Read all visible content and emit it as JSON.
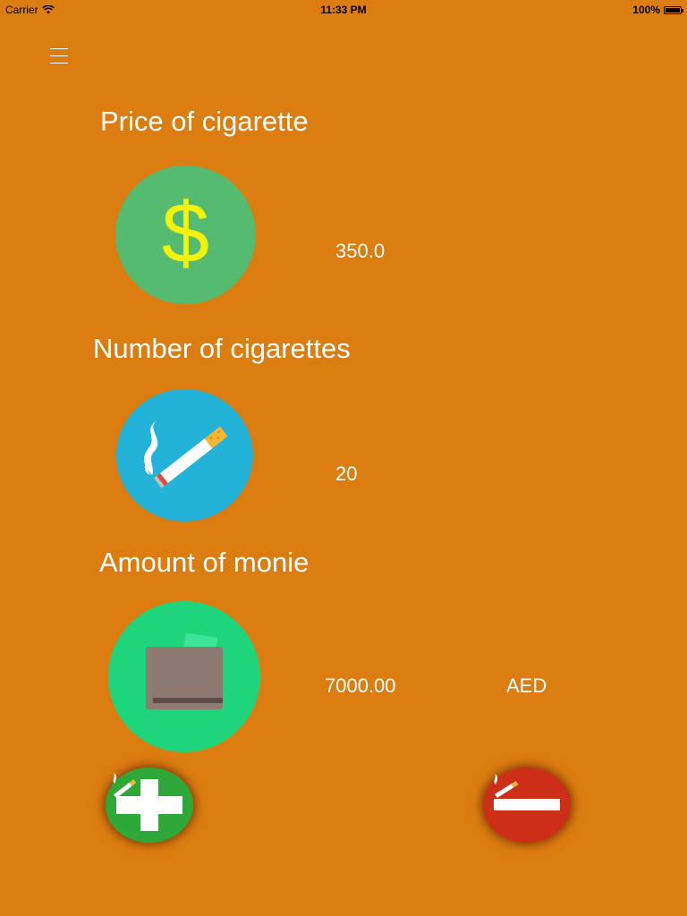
{
  "status_bar": {
    "carrier": "Carrier",
    "time": "11:33 PM",
    "battery": "100%"
  },
  "menu": {
    "icon": "hamburger-menu-icon"
  },
  "price": {
    "title": "Price of cigarette",
    "value": "350.0",
    "icon": "dollar-icon",
    "icon_glyph": "$",
    "circle_color": "#55BB70",
    "icon_color": "#F2F20A"
  },
  "count": {
    "title": "Number of cigarettes",
    "value": "20",
    "icon": "cigarette-icon",
    "circle_color": "#24B3D8"
  },
  "amount": {
    "title": "Amount of monie",
    "value": "7000.00",
    "currency": "AED",
    "icon": "wallet-icon",
    "circle_color": "#1ED57B"
  },
  "actions": {
    "add_icon": "add-cigarette-icon",
    "add_color": "#2FA83A",
    "remove_icon": "remove-cigarette-icon",
    "remove_color": "#CC2E17"
  },
  "colors": {
    "background": "#DC7D11"
  }
}
